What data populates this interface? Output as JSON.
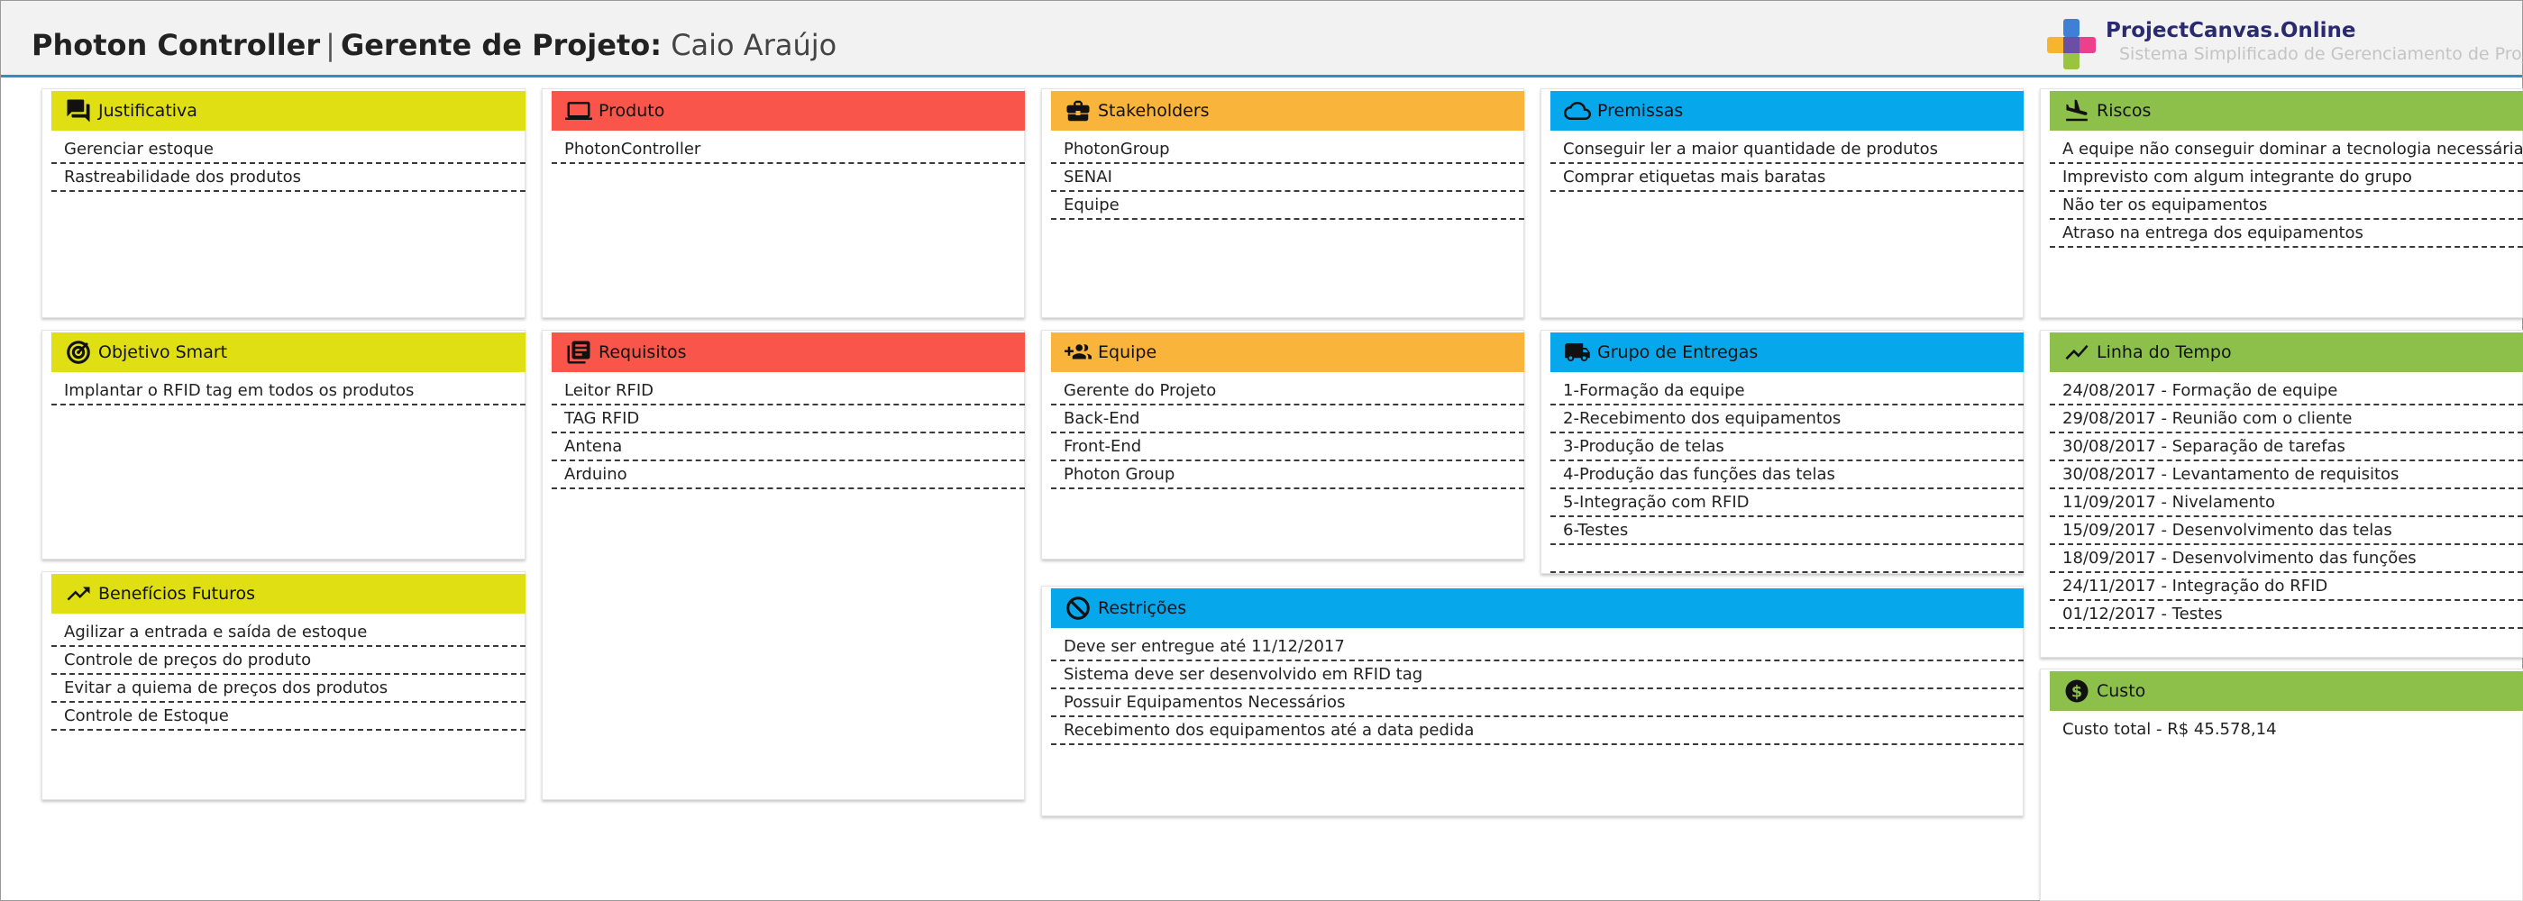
{
  "header": {
    "project_name": "Photon Controller",
    "separator": "|",
    "pm_label": "Gerente de Projeto:",
    "pm_name": "Caio Araújo",
    "brand": "ProjectCanvas.Online",
    "tagline": "Sistema Simplificado de Gerenciamento de Projetos"
  },
  "colors": {
    "yellow": "#dfdf14",
    "red": "#f9554b",
    "orange": "#f9b43c",
    "blue": "#07a7eb",
    "green": "#8cc04b",
    "header_accent": "#2a8fd0"
  },
  "cards": {
    "justificativa": {
      "title": "Justificativa",
      "icon": "chat-icon",
      "items": [
        "Gerenciar estoque",
        "Rastreabilidade dos produtos"
      ]
    },
    "produto": {
      "title": "Produto",
      "icon": "laptop-icon",
      "items": [
        "PhotonController"
      ]
    },
    "stakeholders": {
      "title": "Stakeholders",
      "icon": "briefcase-icon",
      "items": [
        "PhotonGroup",
        "SENAI",
        "Equipe"
      ]
    },
    "premissas": {
      "title": "Premissas",
      "icon": "cloud-icon",
      "items": [
        "Conseguir ler a maior quantidade de produtos",
        "Comprar etiquetas mais baratas"
      ]
    },
    "riscos": {
      "title": "Riscos",
      "icon": "plane-landing-icon",
      "items": [
        "A equipe não conseguir dominar a tecnologia necessária",
        "Imprevisto com algum integrante do grupo",
        "Não ter os equipamentos",
        "Atraso na entrega dos equipamentos"
      ]
    },
    "objetivo": {
      "title": "Objetivo Smart",
      "icon": "target-icon",
      "items": [
        "Implantar o RFID tag em todos os produtos"
      ]
    },
    "requisitos": {
      "title": "Requisitos",
      "icon": "list-book-icon",
      "items": [
        "Leitor RFID",
        "TAG RFID",
        "Antena",
        "Arduino"
      ]
    },
    "equipe": {
      "title": "Equipe",
      "icon": "group-add-icon",
      "items": [
        "Gerente do Projeto",
        "Back-End",
        "Front-End",
        "Photon Group"
      ]
    },
    "entregas": {
      "title": "Grupo de Entregas",
      "icon": "truck-icon",
      "items": [
        "1-Formação da equipe",
        "2-Recebimento dos equipamentos",
        "3-Produção de telas",
        "4-Produção das funções das telas",
        "5-Integração com RFID",
        "6-Testes"
      ]
    },
    "linha": {
      "title": "Linha do Tempo",
      "icon": "trend-line-icon",
      "items": [
        "24/08/2017 - Formação de equipe",
        "29/08/2017 - Reunião com o cliente",
        "30/08/2017 - Separação de tarefas",
        "30/08/2017 - Levantamento de requisitos",
        "11/09/2017 - Nivelamento",
        "15/09/2017 - Desenvolvimento das telas",
        "18/09/2017 - Desenvolvimento das funções",
        "24/11/2017 - Integração do RFID",
        "01/12/2017 - Testes"
      ]
    },
    "beneficios": {
      "title": "Benefícios Futuros",
      "icon": "trending-up-icon",
      "items": [
        "Agilizar a entrada e saída de estoque",
        "Controle de preços do produto",
        "Evitar a quiema de preços dos produtos",
        "Controle de Estoque"
      ]
    },
    "restricoes": {
      "title": "Restrições",
      "icon": "block-icon",
      "items": [
        "Deve ser entregue até 11/12/2017",
        "Sistema deve ser desenvolvido em RFID tag",
        "Possuir Equipamentos Necessários",
        "Recebimento dos equipamentos até a data pedida"
      ]
    },
    "custo": {
      "title": "Custo",
      "icon": "dollar-coin-icon",
      "items": [
        "Custo total - R$ 45.578,14"
      ]
    }
  }
}
